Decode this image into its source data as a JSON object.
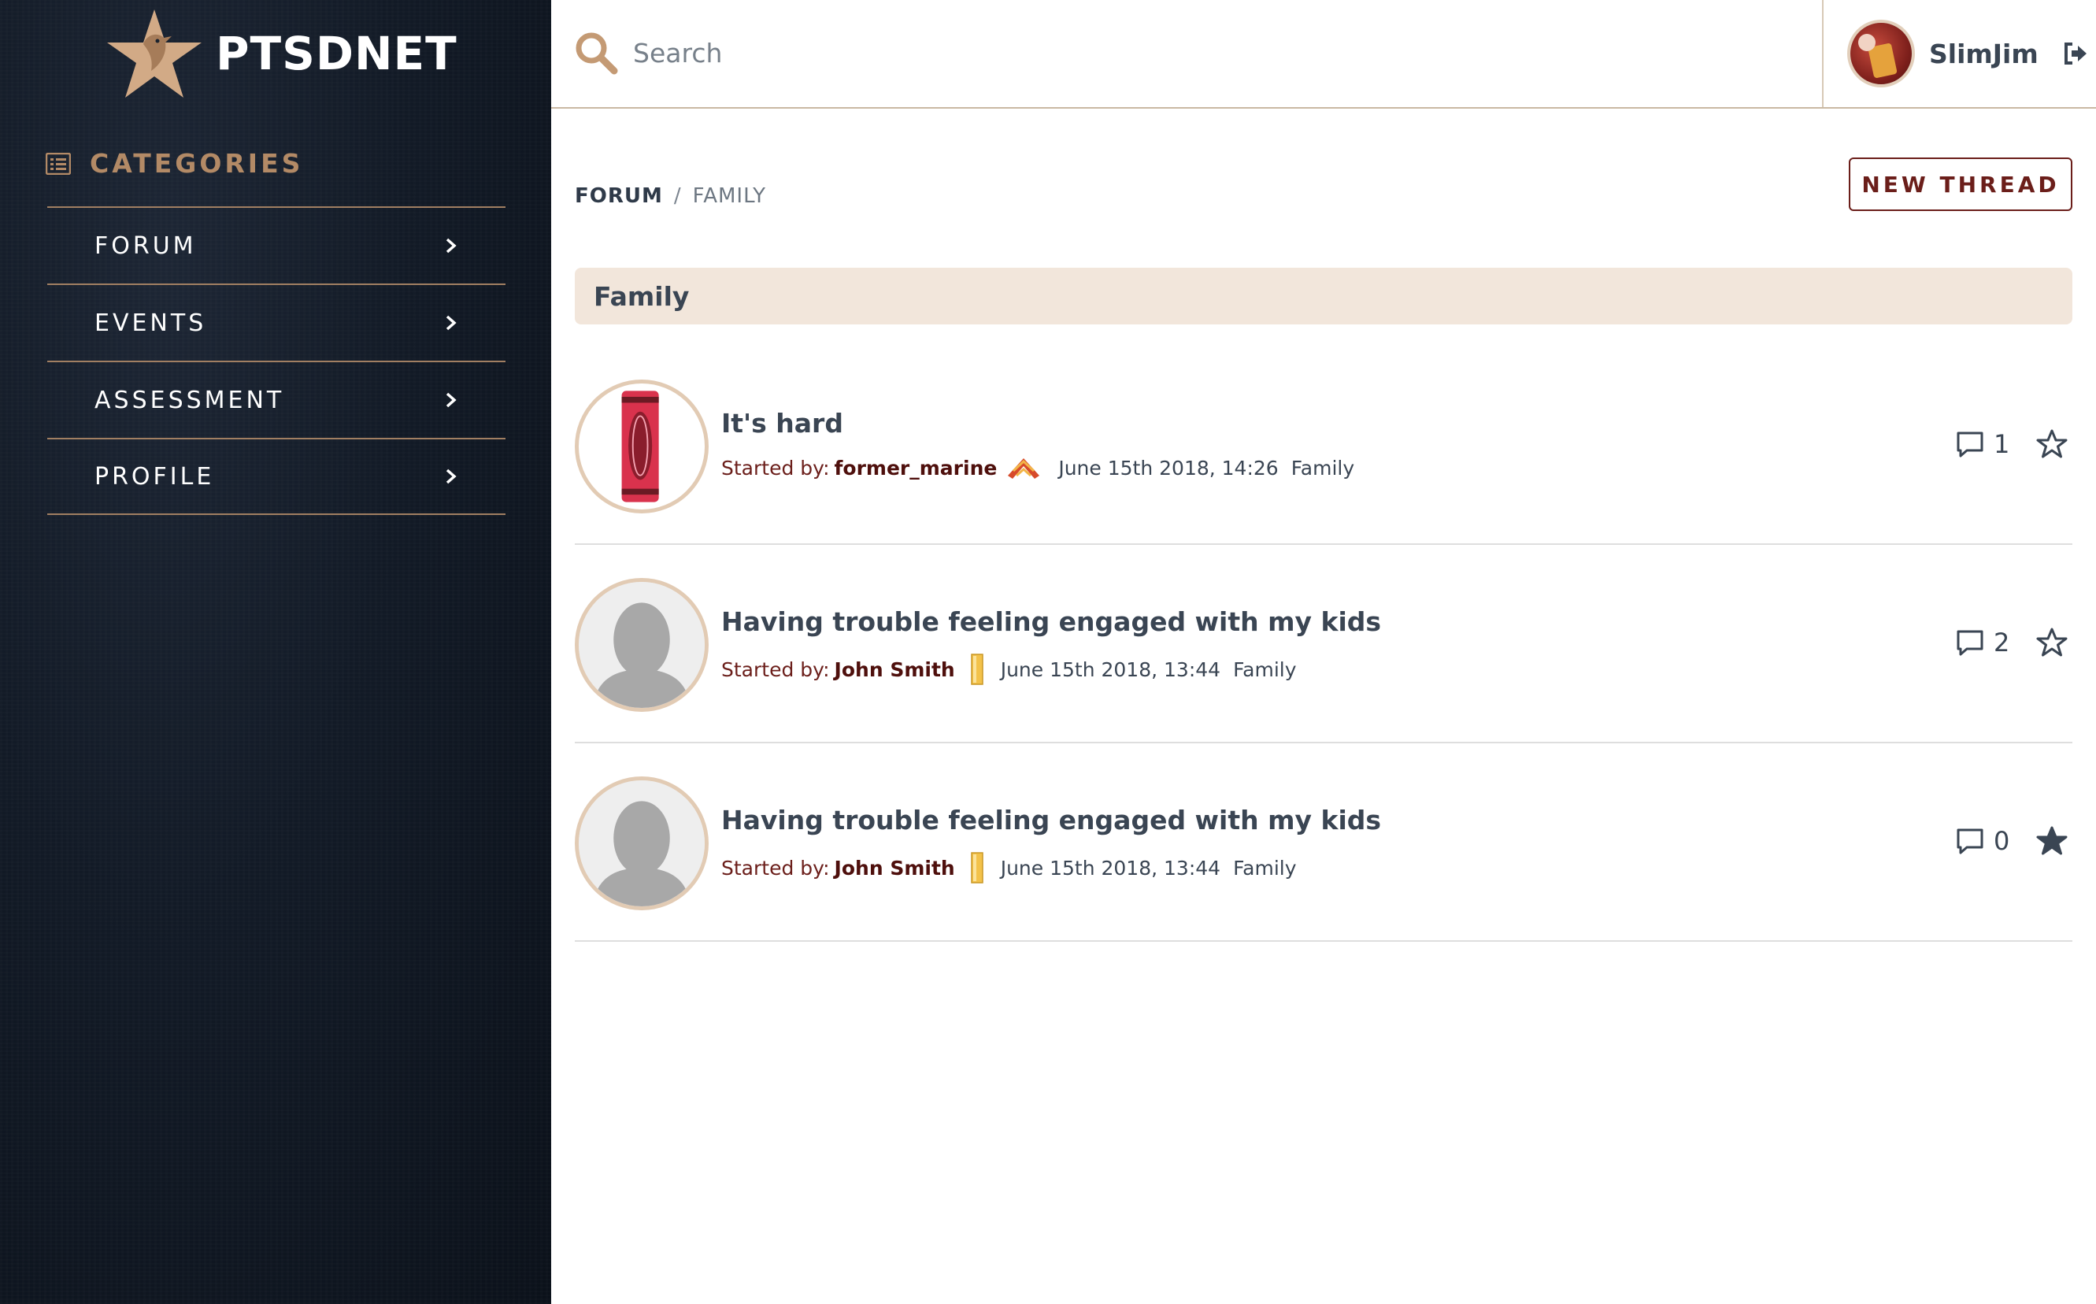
{
  "app": {
    "brand": "PTSDNET"
  },
  "sidebar": {
    "heading": "CATEGORIES",
    "items": [
      {
        "label": "FORUM"
      },
      {
        "label": "EVENTS"
      },
      {
        "label": "ASSESSMENT"
      },
      {
        "label": "PROFILE"
      }
    ]
  },
  "topbar": {
    "search_placeholder": "Search",
    "username": "SlimJim"
  },
  "breadcrumb": {
    "root": "FORUM",
    "separator": "/",
    "current": "FAMILY"
  },
  "toolbar": {
    "new_thread_label": "NEW THREAD"
  },
  "section": {
    "title": "Family"
  },
  "threads": [
    {
      "title": "It's hard",
      "started_label": "Started by:",
      "author": "former_marine",
      "date": "June 15th 2018, 14:26",
      "category": "Family",
      "comments": "1",
      "starred": false
    },
    {
      "title": "Having trouble feeling engaged with my kids",
      "started_label": "Started by:",
      "author": "John Smith",
      "date": "June 15th 2018, 13:44",
      "category": "Family",
      "comments": "2",
      "starred": false
    },
    {
      "title": "Having trouble feeling engaged with my kids",
      "started_label": "Started by:",
      "author": "John Smith",
      "date": "June 15th 2018, 13:44",
      "category": "Family",
      "comments": "0",
      "starred": true
    }
  ],
  "colors": {
    "accent": "#b38a66",
    "sidebar_bg": "#121a26",
    "brand_red": "#6b1e1a",
    "section_bg": "#f2e6db"
  }
}
